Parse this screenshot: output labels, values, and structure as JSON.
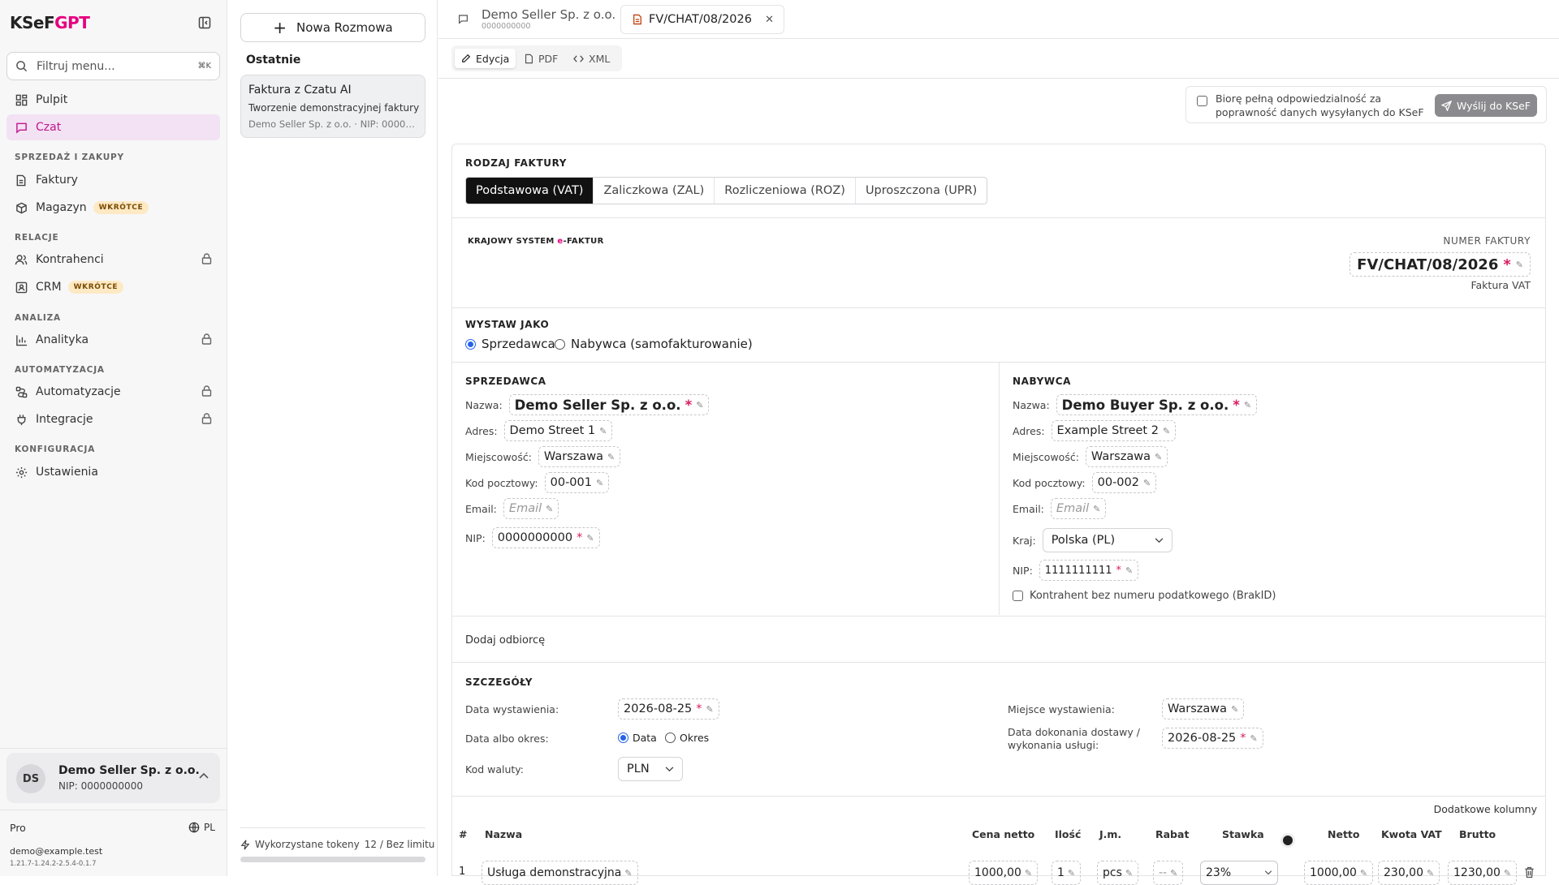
{
  "app": {
    "logo_prefix": "KSeF",
    "logo_suffix": "GPT"
  },
  "sidebar": {
    "filter_placeholder": "Filtruj menu...",
    "filter_shortcut": "⌘K",
    "items": [
      {
        "label": "Pulpit"
      },
      {
        "label": "Czat"
      },
      {
        "label": "Faktury"
      },
      {
        "label": "Magazyn",
        "badge": "WKRÓTCE"
      },
      {
        "label": "Kontrahenci"
      },
      {
        "label": "CRM",
        "badge": "WKRÓTCE"
      },
      {
        "label": "Analityka"
      },
      {
        "label": "Automatyzacje"
      },
      {
        "label": "Integracje"
      },
      {
        "label": "Ustawienia"
      }
    ],
    "sections": [
      "SPRZEDAŻ I ZAKUPY",
      "RELACJE",
      "ANALIZA",
      "AUTOMATYZACJA",
      "KONFIGURACJA"
    ],
    "user": {
      "initials": "DS",
      "name": "Demo Seller Sp. z o.o.",
      "nip": "NIP: 0000000000"
    },
    "plan": "Pro",
    "lang": "PL",
    "email": "demo@example.test",
    "version": "1.21.7-1.24.2-2.5.4-0.1.7"
  },
  "chats": {
    "new_label": "Nowa Rozmowa",
    "recent_label": "Ostatnie",
    "items": [
      {
        "title": "Faktura z Czatu AI",
        "desc": "Tworzenie demonstracyjnej faktury",
        "meta": "Demo Seller Sp. z o.o. · NIP: 0000000000"
      }
    ],
    "tokens_label": "Wykorzystane tokeny",
    "tokens_value": "12 / Bez limitu"
  },
  "tabs": [
    {
      "title": "Demo Seller Sp. z o.o.",
      "subtitle": "0000000000"
    },
    {
      "title": "FV/CHAT/08/2026"
    }
  ],
  "subtabs": [
    "Edycja",
    "PDF",
    "XML"
  ],
  "confirm": {
    "text1": "Biorę pełną odpowiedzialność za",
    "text2": "poprawność danych wysyłanych do KSeF",
    "send_label": "Wyślij do KSeF"
  },
  "invoice": {
    "type_label": "RODZAJ FAKTURY",
    "types": [
      "Podstawowa (VAT)",
      "Zaliczkowa (ZAL)",
      "Rozliczeniowa (ROZ)",
      "Uproszczona (UPR)"
    ],
    "ksef_a": "KRAJOWY SYSTEM ",
    "ksef_e": "e",
    "ksef_b": "-FAKTUR",
    "number_label": "NUMER FAKTURY",
    "number": "FV/CHAT/08/2026",
    "number_type": "Faktura VAT",
    "issue_as_label": "WYSTAW JAKO",
    "issue_as": [
      "Sprzedawca",
      "Nabywca (samofakturowanie)"
    ],
    "seller": {
      "title": "SPRZEDAWCA",
      "name_l": "Nazwa:",
      "name": "Demo Seller Sp. z o.o.",
      "addr_l": "Adres:",
      "addr": "Demo Street 1",
      "city_l": "Miejscowość:",
      "city": "Warszawa",
      "zip_l": "Kod pocztowy:",
      "zip": "00-001",
      "email_l": "Email:",
      "email_ph": "Email",
      "nip_l": "NIP:",
      "nip": "0000000000"
    },
    "buyer": {
      "title": "NABYWCA",
      "name_l": "Nazwa:",
      "name": "Demo Buyer Sp. z o.o.",
      "addr_l": "Adres:",
      "addr": "Example Street 2",
      "city_l": "Miejscowość:",
      "city": "Warszawa",
      "zip_l": "Kod pocztowy:",
      "zip": "00-002",
      "email_l": "Email:",
      "email_ph": "Email",
      "country_l": "Kraj:",
      "country": "Polska (PL)",
      "nip_l": "NIP:",
      "nip": "1111111111",
      "brakid": "Kontrahent bez numeru podatkowego (BrakID)"
    },
    "add_recipient": "Dodaj odbiorcę",
    "details": {
      "title": "SZCZEGÓŁY",
      "issue_date_l": "Data wystawienia:",
      "issue_date": "2026-08-25",
      "date_or_period_l": "Data albo okres:",
      "opt_date": "Data",
      "opt_period": "Okres",
      "currency_l": "Kod waluty:",
      "currency": "PLN",
      "place_l": "Miejsce wystawienia:",
      "place": "Warszawa",
      "delivery_l1": "Data dokonania dostawy /",
      "delivery_l2": "wykonania usługi:",
      "delivery": "2026-08-25"
    },
    "extra_cols": "Dodatkowe kolumny",
    "columns": [
      "#",
      "Nazwa",
      "Cena netto",
      "Ilość",
      "J.m.",
      "Rabat",
      "Stawka",
      "Netto",
      "Kwota VAT",
      "Brutto"
    ],
    "row": {
      "no": "1",
      "name": "Usługa demonstracyjna",
      "price": "1000,00",
      "qty": "1",
      "unit": "pcs",
      "discount": "--",
      "rate": "23%",
      "net": "1000,00",
      "vat": "230,00",
      "gross": "1230,00"
    }
  }
}
